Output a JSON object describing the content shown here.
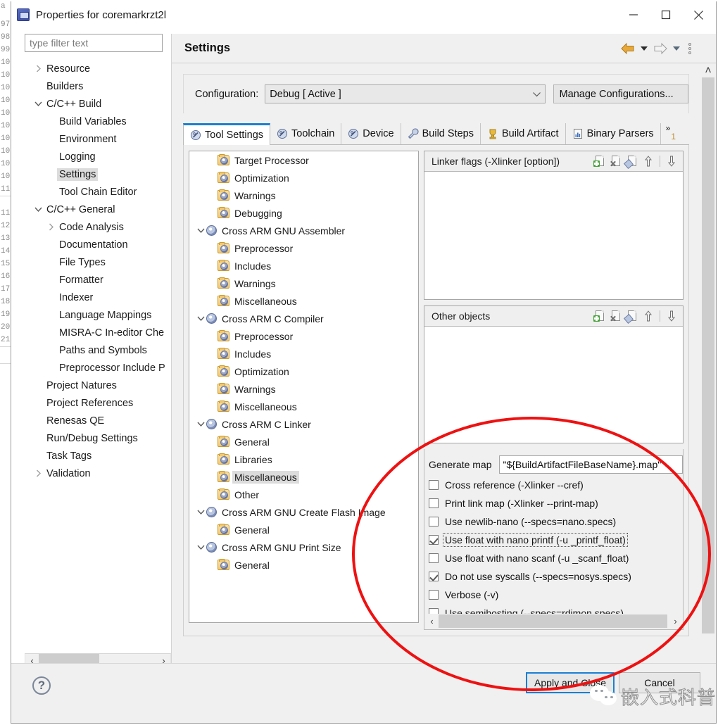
{
  "window": {
    "title": "Properties for coremarkrzt2l",
    "icon": "properties-window-icon",
    "minimize_label": "—",
    "maximize_label": "□",
    "close_label": "✕"
  },
  "filter": {
    "placeholder": "type filter text",
    "value": ""
  },
  "nav_tree": [
    {
      "label": "Resource",
      "level": 0,
      "twisty": "collapsed",
      "selected": false
    },
    {
      "label": "Builders",
      "level": 0,
      "twisty": "none",
      "selected": false
    },
    {
      "label": "C/C++ Build",
      "level": 0,
      "twisty": "expanded",
      "selected": false
    },
    {
      "label": "Build Variables",
      "level": 1,
      "twisty": "none",
      "selected": false
    },
    {
      "label": "Environment",
      "level": 1,
      "twisty": "none",
      "selected": false
    },
    {
      "label": "Logging",
      "level": 1,
      "twisty": "none",
      "selected": false
    },
    {
      "label": "Settings",
      "level": 1,
      "twisty": "none",
      "selected": true
    },
    {
      "label": "Tool Chain Editor",
      "level": 1,
      "twisty": "none",
      "selected": false
    },
    {
      "label": "C/C++ General",
      "level": 0,
      "twisty": "expanded",
      "selected": false
    },
    {
      "label": "Code Analysis",
      "level": 1,
      "twisty": "collapsed",
      "selected": false
    },
    {
      "label": "Documentation",
      "level": 1,
      "twisty": "none",
      "selected": false
    },
    {
      "label": "File Types",
      "level": 1,
      "twisty": "none",
      "selected": false
    },
    {
      "label": "Formatter",
      "level": 1,
      "twisty": "none",
      "selected": false
    },
    {
      "label": "Indexer",
      "level": 1,
      "twisty": "none",
      "selected": false
    },
    {
      "label": "Language Mappings",
      "level": 1,
      "twisty": "none",
      "selected": false
    },
    {
      "label": "MISRA-C In-editor Che",
      "level": 1,
      "twisty": "none",
      "selected": false
    },
    {
      "label": "Paths and Symbols",
      "level": 1,
      "twisty": "none",
      "selected": false
    },
    {
      "label": "Preprocessor Include P",
      "level": 1,
      "twisty": "none",
      "selected": false
    },
    {
      "label": "Project Natures",
      "level": 0,
      "twisty": "none",
      "selected": false
    },
    {
      "label": "Project References",
      "level": 0,
      "twisty": "none",
      "selected": false
    },
    {
      "label": "Renesas QE",
      "level": 0,
      "twisty": "none",
      "selected": false
    },
    {
      "label": "Run/Debug Settings",
      "level": 0,
      "twisty": "none",
      "selected": false
    },
    {
      "label": "Task Tags",
      "level": 0,
      "twisty": "none",
      "selected": false
    },
    {
      "label": "Validation",
      "level": 0,
      "twisty": "collapsed",
      "selected": false
    }
  ],
  "settings": {
    "title": "Settings",
    "nav_back": "back-arrow",
    "nav_forward": "forward-arrow",
    "menu": "view-menu-dots"
  },
  "configuration": {
    "label": "Configuration:",
    "value": "Debug  [ Active ]",
    "manage_button": "Manage Configurations..."
  },
  "tabs": [
    {
      "label": "Tool Settings",
      "icon": "tool-icon",
      "active": true
    },
    {
      "label": "Toolchain",
      "icon": "tool-icon",
      "active": false
    },
    {
      "label": "Device",
      "icon": "tool-icon",
      "active": false
    },
    {
      "label": "Build Steps",
      "icon": "wrench-icon",
      "active": false
    },
    {
      "label": "Build Artifact",
      "icon": "artifact-icon",
      "active": false
    },
    {
      "label": "Binary Parsers",
      "icon": "parser-icon",
      "active": false
    }
  ],
  "tabs_overflow": {
    "symbol": "»",
    "count": "1"
  },
  "tool_tree": [
    {
      "label": "Target Processor",
      "level": 1,
      "icon": "folder-tool-icon",
      "twisty": "none",
      "selected": false
    },
    {
      "label": "Optimization",
      "level": 1,
      "icon": "folder-tool-icon",
      "twisty": "none",
      "selected": false
    },
    {
      "label": "Warnings",
      "level": 1,
      "icon": "folder-tool-icon",
      "twisty": "none",
      "selected": false
    },
    {
      "label": "Debugging",
      "level": 1,
      "icon": "folder-tool-icon",
      "twisty": "none",
      "selected": false
    },
    {
      "label": "Cross ARM GNU Assembler",
      "level": 0,
      "icon": "tool-icon",
      "twisty": "expanded",
      "selected": false
    },
    {
      "label": "Preprocessor",
      "level": 1,
      "icon": "folder-tool-icon",
      "twisty": "none",
      "selected": false
    },
    {
      "label": "Includes",
      "level": 1,
      "icon": "folder-tool-icon",
      "twisty": "none",
      "selected": false
    },
    {
      "label": "Warnings",
      "level": 1,
      "icon": "folder-tool-icon",
      "twisty": "none",
      "selected": false
    },
    {
      "label": "Miscellaneous",
      "level": 1,
      "icon": "folder-tool-icon",
      "twisty": "none",
      "selected": false
    },
    {
      "label": "Cross ARM C Compiler",
      "level": 0,
      "icon": "tool-icon",
      "twisty": "expanded",
      "selected": false
    },
    {
      "label": "Preprocessor",
      "level": 1,
      "icon": "folder-tool-icon",
      "twisty": "none",
      "selected": false
    },
    {
      "label": "Includes",
      "level": 1,
      "icon": "folder-tool-icon",
      "twisty": "none",
      "selected": false
    },
    {
      "label": "Optimization",
      "level": 1,
      "icon": "folder-tool-icon",
      "twisty": "none",
      "selected": false
    },
    {
      "label": "Warnings",
      "level": 1,
      "icon": "folder-tool-icon",
      "twisty": "none",
      "selected": false
    },
    {
      "label": "Miscellaneous",
      "level": 1,
      "icon": "folder-tool-icon",
      "twisty": "none",
      "selected": false
    },
    {
      "label": "Cross ARM C Linker",
      "level": 0,
      "icon": "tool-icon",
      "twisty": "expanded",
      "selected": false
    },
    {
      "label": "General",
      "level": 1,
      "icon": "folder-tool-icon",
      "twisty": "none",
      "selected": false
    },
    {
      "label": "Libraries",
      "level": 1,
      "icon": "folder-tool-icon",
      "twisty": "none",
      "selected": false
    },
    {
      "label": "Miscellaneous",
      "level": 1,
      "icon": "folder-tool-icon",
      "twisty": "none",
      "selected": true
    },
    {
      "label": "Other",
      "level": 1,
      "icon": "folder-tool-icon",
      "twisty": "none",
      "selected": false
    },
    {
      "label": "Cross ARM GNU Create Flash Image",
      "level": 0,
      "icon": "tool-icon",
      "twisty": "expanded",
      "selected": false
    },
    {
      "label": "General",
      "level": 1,
      "icon": "folder-tool-icon",
      "twisty": "none",
      "selected": false
    },
    {
      "label": "Cross ARM GNU Print Size",
      "level": 0,
      "icon": "tool-icon",
      "twisty": "expanded",
      "selected": false
    },
    {
      "label": "General",
      "level": 1,
      "icon": "folder-tool-icon",
      "twisty": "none",
      "selected": false
    }
  ],
  "linker_flags_panel": {
    "title": "Linker flags (-Xlinker [option])",
    "items": [],
    "toolbar": [
      "add-icon",
      "delete-icon",
      "edit-icon",
      "move-up-icon",
      "move-down-icon"
    ]
  },
  "other_objects_panel": {
    "title": "Other objects",
    "items": [],
    "toolbar": [
      "add-icon",
      "delete-icon",
      "edit-icon",
      "move-up-icon",
      "move-down-icon"
    ]
  },
  "options": {
    "generate_map_label": "Generate map",
    "generate_map_value": "\"${BuildArtifactFileBaseName}.map\"",
    "checkboxes": [
      {
        "label": "Cross reference (-Xlinker --cref)",
        "checked": false,
        "focused": false
      },
      {
        "label": "Print link map (-Xlinker --print-map)",
        "checked": false,
        "focused": false
      },
      {
        "label": "Use newlib-nano (--specs=nano.specs)",
        "checked": false,
        "focused": false
      },
      {
        "label": "Use float with nano printf (-u _printf_float)",
        "checked": true,
        "focused": true
      },
      {
        "label": "Use float with nano scanf (-u _scanf_float)",
        "checked": false,
        "focused": false
      },
      {
        "label": "Do not use syscalls (--specs=nosys.specs)",
        "checked": true,
        "focused": false
      },
      {
        "label": "Verbose (-v)",
        "checked": false,
        "focused": false
      },
      {
        "label": "Use semihosting (--specs=rdimon.specs)",
        "checked": false,
        "focused": false
      }
    ]
  },
  "footer": {
    "help": "?",
    "apply_and_close": "Apply and Close",
    "cancel": "Cancel"
  },
  "annotation": {
    "shape": "red-ellipse-highlight",
    "color": "#ee1111"
  },
  "watermark": {
    "text": "嵌入式科普",
    "logo": "wechat-logo"
  },
  "scrollbars": {
    "left_arrow": "‹",
    "right_arrow": "›",
    "up_arrow": "˄",
    "down_arrow": "˅"
  }
}
